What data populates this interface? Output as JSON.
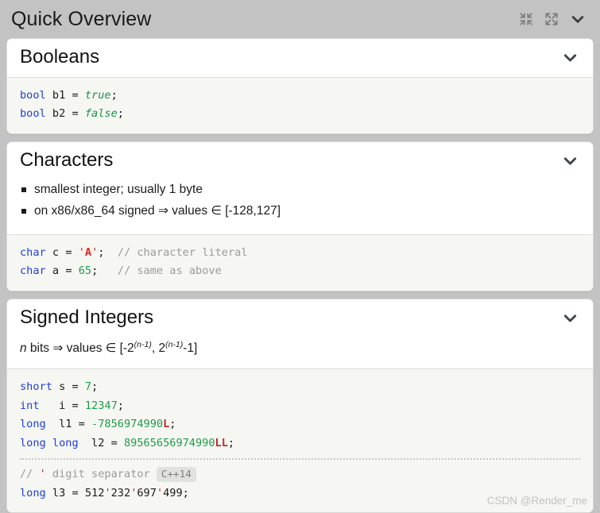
{
  "window": {
    "title": "Quick Overview",
    "icons": [
      {
        "name": "compress-icon",
        "label": "compress"
      },
      {
        "name": "expand-icon",
        "label": "expand"
      },
      {
        "name": "chevron-down-icon",
        "label": "collapse"
      }
    ]
  },
  "colors": {
    "titlebar_bg": "#c3c3c3",
    "card_bg": "#ffffff",
    "code_bg": "#f6f7f2",
    "keyword": "#1d3fe0",
    "literal_number": "#1f9c4c",
    "literal_bool": "#17934a",
    "char_literal": "#e8201f",
    "suffix": "#c1272d",
    "comment": "#9a9a9a",
    "badge_bg": "#e2e2dd",
    "badge_text": "#7e7e7e",
    "watermark": "#c2c2c2"
  },
  "sections": [
    {
      "id": "booleans",
      "title": "Booleans",
      "chevron": "chevron-down-icon",
      "bullets": [],
      "formula": null,
      "code_lines": [
        {
          "text": "bool b1 = true;"
        },
        {
          "text": "bool b2 = false;"
        }
      ]
    },
    {
      "id": "characters",
      "title": "Characters",
      "chevron": "chevron-down-icon",
      "bullets": [
        "smallest integer; usually 1 byte",
        "on x86/x86_64 signed ⇒ values ∈ [-128,127]"
      ],
      "formula": null,
      "code_lines": [
        {
          "text": "char c = 'A';  // character literal"
        },
        {
          "text": "char a = 65;   // same as above"
        }
      ]
    },
    {
      "id": "signed-integers",
      "title": "Signed Integers",
      "chevron": "chevron-down-icon",
      "bullets": [],
      "formula": "n bits ⇒ values ∈ [-2(n-1), 2(n-1)-1]",
      "formula_parts": {
        "var": "n",
        "text_1": " bits ⇒ values ∈ [-2",
        "sup_1": "(n-1)",
        "text_2": ", 2",
        "sup_2": "(n-1)",
        "text_3": "-1]"
      },
      "code_lines": [
        {
          "text": "short s = 7;"
        },
        {
          "text": "int   i = 12347;"
        },
        {
          "text": "long  l1 = -7856974990L;"
        },
        {
          "text": "long long  l2 = 89565656974990LL;"
        },
        {
          "text": "// ' digit separator  C++14"
        },
        {
          "text": "long l3 = 512'232'697'499;"
        }
      ],
      "badge": "C++14"
    }
  ],
  "watermark": "CSDN @Render_me"
}
